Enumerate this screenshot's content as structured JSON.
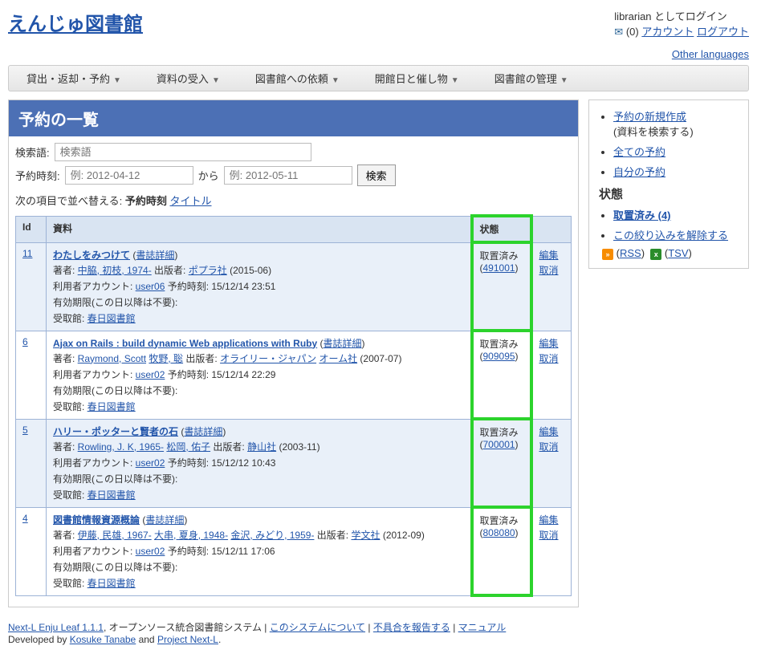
{
  "site": {
    "title": "えんじゅ図書館"
  },
  "login": {
    "as": "librarian としてログイン",
    "count": "(0)",
    "account": "アカウント",
    "logout": "ログアウト"
  },
  "other_lang": "Other languages",
  "menu": [
    "貸出・返却・予約",
    "資料の受入",
    "図書館への依頼",
    "開館日と催し物",
    "図書館の管理"
  ],
  "page": {
    "header": "予約の一覧",
    "search_label": "検索語:",
    "search_placeholder": "検索語",
    "reserve_time_label": "予約時刻:",
    "from_placeholder": "例: 2012-04-12",
    "to_word": "から",
    "to_placeholder": "例: 2012-05-11",
    "search_btn": "検索",
    "sort_prefix": "次の項目で並べ替える:",
    "sort_current": "予約時刻",
    "sort_other": "タイトル"
  },
  "columns": {
    "id": "Id",
    "material": "資料",
    "status": "状態",
    "actions": ""
  },
  "labels": {
    "author": "著者:",
    "publisher": "出版者:",
    "bib_detail": "書誌詳細",
    "account": "利用者アカウント:",
    "reserved_at": "予約時刻:",
    "expiry": "有効期限(この日以降は不要):",
    "pickup": "受取館:",
    "status_retained": "取置済み",
    "edit": "編集",
    "cancel": "取消"
  },
  "rows": [
    {
      "alt": true,
      "id": "11",
      "title": "わたしをみつけて",
      "authors": [
        "中脇, 初枝, 1974-"
      ],
      "publisher": "ポプラ社",
      "pub_date": "(2015-06)",
      "account": "user06",
      "reserved_at": "15/12/14 23:51",
      "pickup": "春日図書館",
      "status_id": "491001"
    },
    {
      "alt": false,
      "id": "6",
      "title": "Ajax on Rails : build dynamic Web applications with Ruby",
      "authors": [
        "Raymond, Scott",
        "牧野, 聡"
      ],
      "publisher": "オライリー・ジャパン",
      "publisher2": "オーム社",
      "pub_date": "(2007-07)",
      "account": "user02",
      "reserved_at": "15/12/14 22:29",
      "pickup": "春日図書館",
      "status_id": "909095"
    },
    {
      "alt": true,
      "id": "5",
      "title": "ハリー・ポッターと賢者の石",
      "authors": [
        "Rowling, J. K, 1965-",
        "松岡, 佑子"
      ],
      "publisher": "静山社",
      "pub_date": "(2003-11)",
      "account": "user02",
      "reserved_at": "15/12/12 10:43",
      "pickup": "春日図書館",
      "status_id": "700001"
    },
    {
      "alt": false,
      "id": "4",
      "title": "図書館情報資源概論",
      "authors": [
        "伊藤, 民雄, 1967-",
        "大串, 夏身, 1948-",
        "金沢, みどり, 1959-"
      ],
      "publisher": "学文社",
      "pub_date": "(2012-09)",
      "account": "user02",
      "reserved_at": "15/12/11 17:06",
      "pickup": "春日図書館",
      "status_id": "808080"
    }
  ],
  "side": {
    "new_reserve": "予約の新規作成",
    "new_reserve_note": "(資料を検索する)",
    "all_reserves": "全ての予約",
    "my_reserves": "自分の予約",
    "state_heading": "状態",
    "retained_count": "取置済み (4)",
    "clear_filter": "この絞り込みを解除する",
    "rss": "RSS",
    "tsv": "TSV"
  },
  "footer": {
    "product": "Next-L Enju Leaf 1.1.1",
    "suffix": ", オープンソース統合図書館システム",
    "about": "このシステムについて",
    "report": "不具合を報告する",
    "manual": "マニュアル",
    "dev_prefix": "Developed by ",
    "dev1": "Kosuke Tanabe",
    "and": " and ",
    "dev2": "Project Next-L",
    "period": "."
  }
}
